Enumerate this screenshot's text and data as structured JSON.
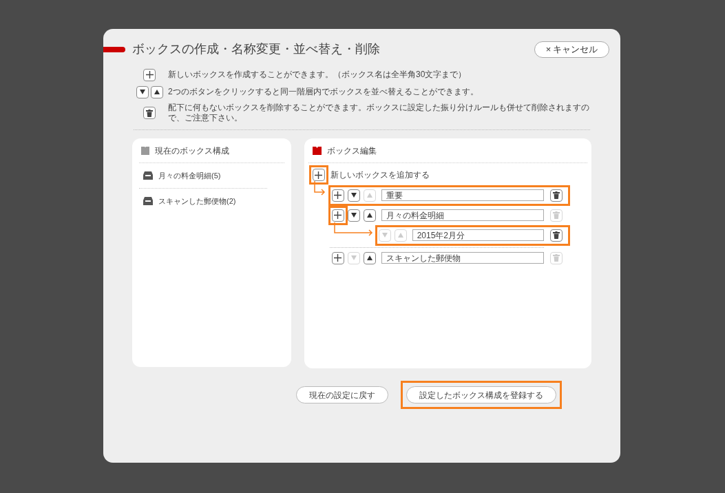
{
  "dialog": {
    "title": "ボックスの作成・名称変更・並べ替え・削除",
    "cancel_button": {
      "icon": "×",
      "label": "キャンセル"
    }
  },
  "help": [
    {
      "kind": "add",
      "text": "新しいボックスを作成することができます。（ボックス名は全半角30文字まで）"
    },
    {
      "kind": "sort",
      "text": "2つのボタンをクリックすると同一階層内でボックスを並べ替えることができます。"
    },
    {
      "kind": "delete",
      "text": "配下に何もないボックスを削除することができます。ボックスに設定した振り分けルールも併せて削除されますので、ご注意下さい。"
    }
  ],
  "current_panel": {
    "title": "現在のボックス構成",
    "items": [
      "月々の料金明細(5)",
      "スキャンした郵便物(2)"
    ]
  },
  "edit_panel": {
    "title": "ボックス編集",
    "add_label": "新しいボックスを追加する",
    "add_highlighted": true,
    "boxes": [
      {
        "name": "重要",
        "can_add": true,
        "add_highlighted": false,
        "down_enabled": true,
        "up_enabled": false,
        "delete_enabled": true,
        "highlighted": true
      },
      {
        "name": "月々の料金明細",
        "can_add": true,
        "add_highlighted": true,
        "down_enabled": true,
        "up_enabled": true,
        "delete_enabled": false,
        "highlighted": false,
        "children": [
          {
            "name": "2015年2月分",
            "can_add": false,
            "down_enabled": false,
            "up_enabled": false,
            "delete_enabled": true,
            "highlighted": true
          }
        ]
      },
      {
        "name": "スキャンした郵便物",
        "can_add": true,
        "add_highlighted": false,
        "down_enabled": false,
        "up_enabled": true,
        "delete_enabled": false,
        "highlighted": false
      }
    ]
  },
  "footer": [
    {
      "label": "現在の設定に戻す",
      "highlighted": false
    },
    {
      "label": "設定したボックス構成を登録する",
      "highlighted": true
    }
  ]
}
